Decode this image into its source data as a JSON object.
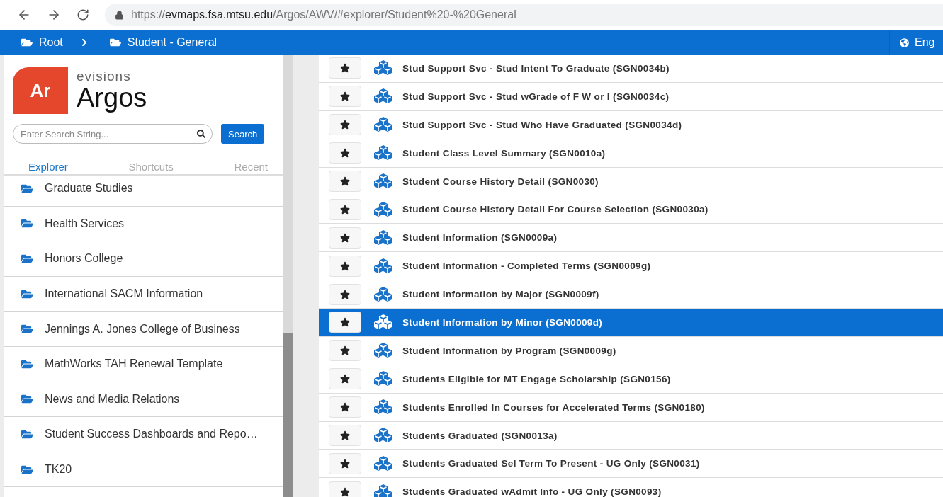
{
  "browser": {
    "url": {
      "scheme": "https://",
      "host": "evmaps.fsa.mtsu.edu",
      "path": "/Argos/AWV/#explorer/Student%20-%20General"
    }
  },
  "breadcrumb": [
    "Root",
    "Student - General"
  ],
  "language": "Eng",
  "logo": {
    "mark": "Ar",
    "brand": "evisions",
    "product": "Argos"
  },
  "search": {
    "placeholder": "Enter Search String...",
    "button": "Search"
  },
  "tabs": [
    {
      "label": "Explorer",
      "selected": true
    },
    {
      "label": "Shortcuts",
      "selected": false
    },
    {
      "label": "Recent",
      "selected": false
    }
  ],
  "folders": [
    "Graduate Studies",
    "Health Services",
    "Honors College",
    "International SACM Information",
    "Jennings A. Jones College of Business",
    "MathWorks TAH Renewal Template",
    "News and Media Relations",
    "Student Success Dashboards and Repo…",
    "TK20"
  ],
  "reports": [
    {
      "name": "Stud Support Svc - Stud Intent To Graduate (SGN0034b)",
      "selected": false
    },
    {
      "name": "Stud Support Svc - Stud wGrade of F W or I (SGN0034c)",
      "selected": false
    },
    {
      "name": "Stud Support Svc - Stud Who Have Graduated (SGN0034d)",
      "selected": false
    },
    {
      "name": "Student Class Level Summary (SGN0010a)",
      "selected": false
    },
    {
      "name": "Student Course History Detail (SGN0030)",
      "selected": false
    },
    {
      "name": "Student Course History Detail For Course Selection (SGN0030a)",
      "selected": false
    },
    {
      "name": "Student Information (SGN0009a)",
      "selected": false
    },
    {
      "name": "Student Information - Completed Terms (SGN0009g)",
      "selected": false
    },
    {
      "name": "Student Information by Major (SGN0009f)",
      "selected": false
    },
    {
      "name": "Student Information by Minor (SGN0009d)",
      "selected": true
    },
    {
      "name": "Student Information by Program (SGN0009g)",
      "selected": false
    },
    {
      "name": "Students Eligible for MT Engage Scholarship (SGN0156)",
      "selected": false
    },
    {
      "name": "Students Enrolled In Courses for Accelerated Terms (SGN0180)",
      "selected": false
    },
    {
      "name": "Students Graduated (SGN0013a)",
      "selected": false
    },
    {
      "name": "Students Graduated Sel Term To Present - UG Only (SGN0031)",
      "selected": false
    },
    {
      "name": "Students Graduated wAdmit Info - UG Only (SGN0093)",
      "selected": false
    }
  ]
}
